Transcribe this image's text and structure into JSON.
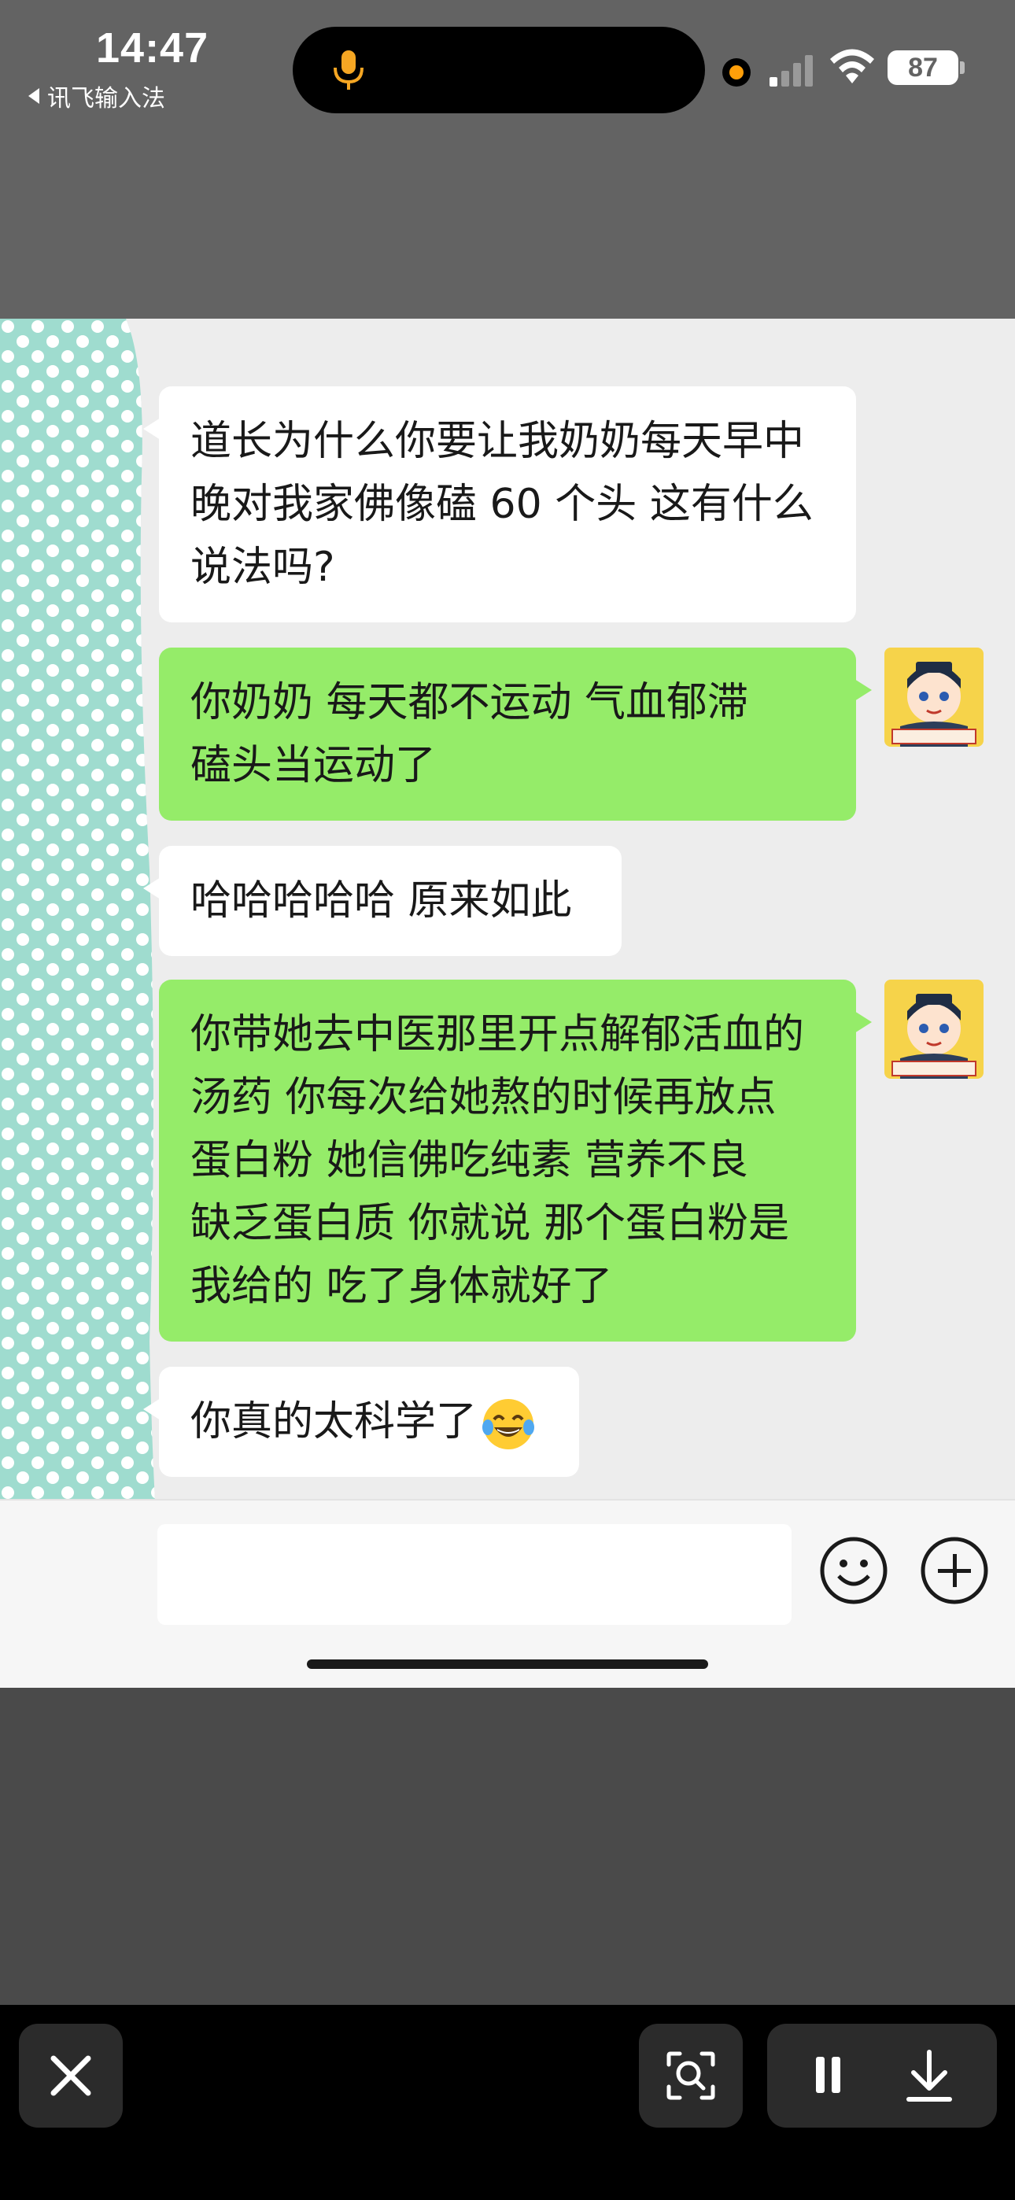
{
  "status_bar": {
    "time": "14:47",
    "back_app": "讯飞输入法",
    "battery": "87",
    "recording_indicator_color": "#ff9f0a",
    "mic_color": "#f5a623",
    "icons": [
      "mic-icon",
      "camera-dot-icon",
      "cellular-signal-icon",
      "wifi-icon",
      "battery-icon"
    ]
  },
  "chat": {
    "bubble_colors": {
      "incoming": "#ffffff",
      "outgoing": "#95ec69"
    },
    "messages": [
      {
        "side": "left",
        "lines": [
          "道长为什么你要让我奶奶每天早中",
          "晚对我家佛像磕 60 个头  这有什么",
          "说法吗?"
        ]
      },
      {
        "side": "right",
        "lines": [
          "你奶奶  每天都不运动  气血郁滞",
          "磕头当运动了"
        ]
      },
      {
        "side": "left",
        "lines": [
          "哈哈哈哈哈 原来如此"
        ]
      },
      {
        "side": "right",
        "lines": [
          "你带她去中医那里开点解郁活血的",
          "汤药  你每次给她熬的时候再放点",
          "蛋白粉  她信佛吃纯素  营养不良",
          "缺乏蛋白质  你就说 那个蛋白粉是",
          "我给的 吃了身体就好了"
        ]
      },
      {
        "side": "left",
        "lines": [
          "你真的太科学了"
        ],
        "emoji": "laughing-tears-emoji"
      }
    ],
    "input": {
      "value": ""
    },
    "input_icons": [
      "emoji-icon",
      "plus-icon"
    ]
  },
  "toolbar": {
    "icons": [
      "close-icon",
      "scan-icon",
      "pause-icon",
      "download-icon"
    ]
  }
}
